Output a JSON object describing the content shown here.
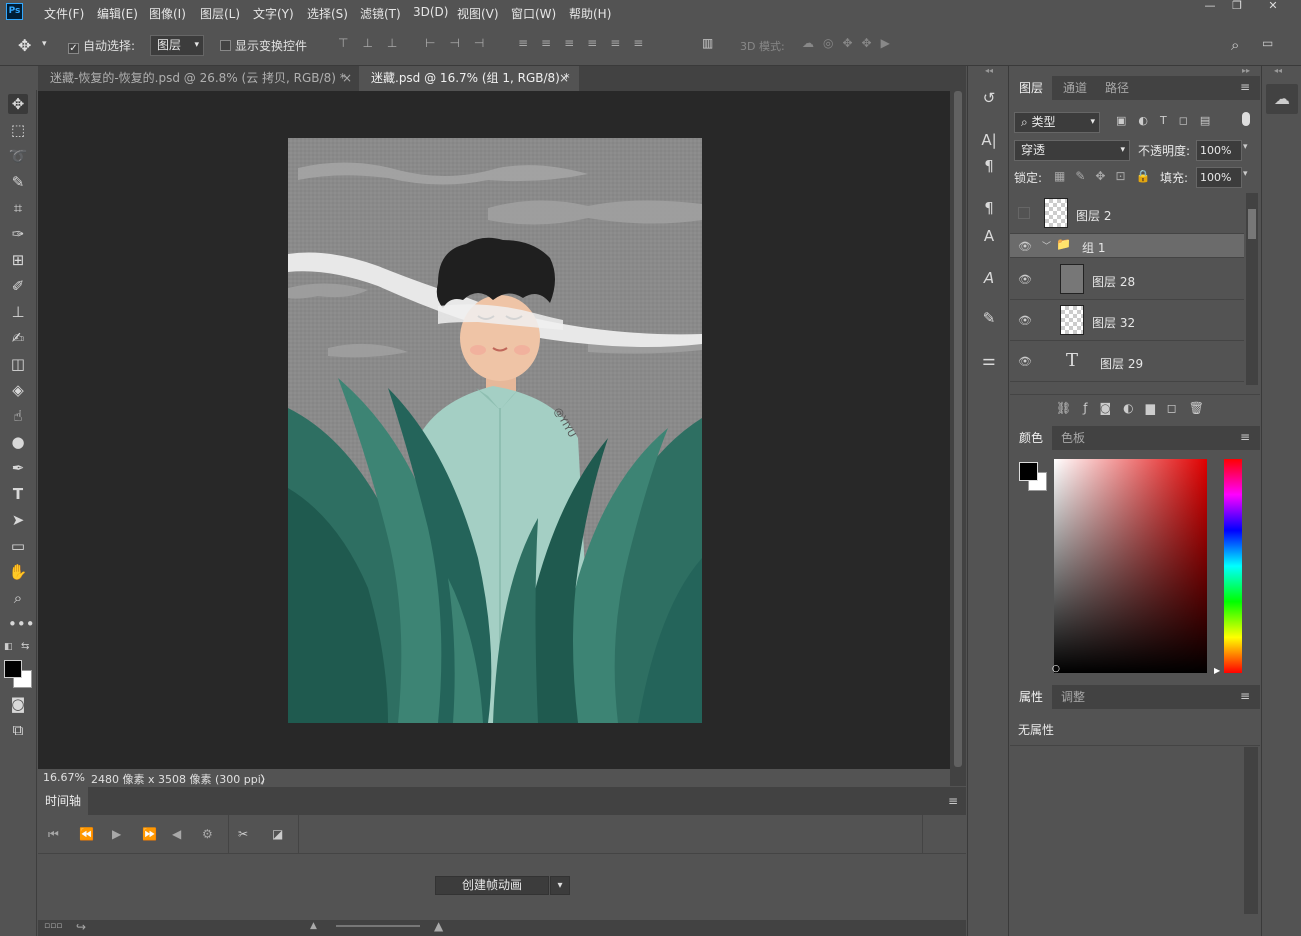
{
  "app": {
    "logo": "Ps"
  },
  "menu": [
    "文件(F)",
    "编辑(E)",
    "图像(I)",
    "图层(L)",
    "文字(Y)",
    "选择(S)",
    "滤镜(T)",
    "3D(D)",
    "视图(V)",
    "窗口(W)",
    "帮助(H)"
  ],
  "window_controls": {
    "minimize": "—",
    "restore": "❐",
    "close": "✕"
  },
  "options": {
    "auto_select_label": "自动选择:",
    "auto_select_value": "图层",
    "show_transform_label": "显示变换控件",
    "mode_3d_label": "3D 模式:"
  },
  "tabs": [
    {
      "label": "迷藏-恢复的-恢复的.psd @ 26.8% (云 拷贝, RGB/8) *",
      "close": "×"
    },
    {
      "label": "迷藏.psd @ 16.7% (组 1, RGB/8) *",
      "close": "×"
    }
  ],
  "status": {
    "zoom": "16.67%",
    "doc_info": "2480 像素 x 3508 像素 (300 ppi)",
    "arrow": "〉"
  },
  "timeline": {
    "title": "时间轴",
    "create_button": "创建帧动画"
  },
  "artwork": {
    "signature": "@YIYU"
  },
  "layers_panel": {
    "tabs": [
      "图层",
      "通道",
      "路径"
    ],
    "filter_label": "类型",
    "blend_mode": "穿透",
    "opacity_label": "不透明度:",
    "opacity_value": "100%",
    "lock_label": "锁定:",
    "fill_label": "填充:",
    "fill_value": "100%",
    "layers": [
      {
        "name": "图层 2",
        "visible": false,
        "kind": "pixel"
      },
      {
        "name": "组 1",
        "visible": true,
        "kind": "group",
        "selected": true
      },
      {
        "name": "图层 28",
        "visible": true,
        "kind": "pixel"
      },
      {
        "name": "图层 32",
        "visible": true,
        "kind": "pixel"
      },
      {
        "name": "图层 29",
        "visible": true,
        "kind": "text"
      }
    ]
  },
  "color_panel": {
    "tabs": [
      "颜色",
      "色板"
    ],
    "foreground": "#000000",
    "background": "#ffffff"
  },
  "props_panel": {
    "tabs": [
      "属性",
      "调整"
    ],
    "empty_text": "无属性"
  }
}
